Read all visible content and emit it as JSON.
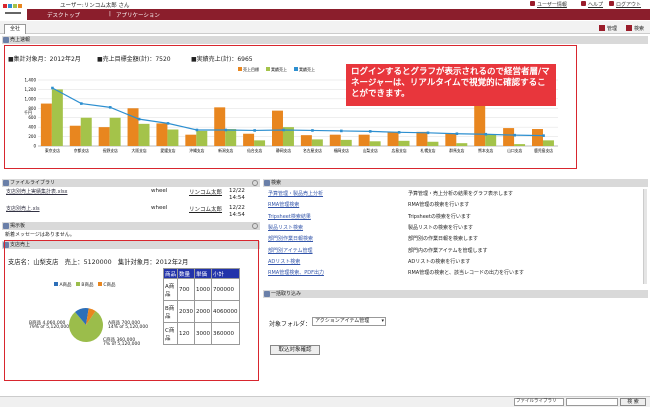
{
  "header": {
    "user": "ユーザー:リンコム太郎 さん",
    "links": [
      "ユーザー情報",
      "ヘルプ",
      "ログアウト"
    ]
  },
  "nav": {
    "items": [
      "デスクトップ",
      "アプリケーション"
    ]
  },
  "tab": {
    "label": "全社"
  },
  "top_right": {
    "manage": "管理",
    "search": "検索"
  },
  "sales_panel": {
    "title": "売上速報",
    "period": "■集計対象月：2012年2月",
    "target": "■売上目標金額(計)：7520",
    "actual": "■実績売上(計)：6965",
    "overlay": "ログインするとグラフが表示されるので経営者層/マネージャーは、リアルタイムで視覚的に確認することができます。"
  },
  "chart_data": {
    "type": "bar",
    "categories": [
      "東京支店",
      "京都支店",
      "長野支店",
      "大阪支店",
      "愛媛支店",
      "沖縄支店",
      "新潟支店",
      "仙台支店",
      "静岡支店",
      "名古屋支店",
      "福岡支店",
      "山梨支店",
      "広島支店",
      "札幌支店",
      "群馬支店",
      "熊本支店",
      "山口支店",
      "鹿児島支店"
    ],
    "series": [
      {
        "name": "売上目標",
        "values": [
          900,
          430,
          400,
          800,
          480,
          240,
          820,
          260,
          750,
          230,
          240,
          240,
          300,
          300,
          270,
          1000,
          380,
          360
        ],
        "color": "#e8861f"
      },
      {
        "name": "実績売上",
        "values": [
          1200,
          600,
          600,
          470,
          350,
          320,
          360,
          120,
          400,
          140,
          130,
          100,
          110,
          90,
          60,
          240,
          40,
          120
        ],
        "color": "#a4c34a"
      },
      {
        "name": "実績売上",
        "values": [
          1230,
          900,
          820,
          570,
          480,
          340,
          340,
          330,
          340,
          330,
          320,
          310,
          290,
          280,
          260,
          250,
          230,
          220
        ],
        "color": "#2d8fd0"
      }
    ],
    "ylim": [
      0,
      1400
    ],
    "yticks": [
      "0",
      "200",
      "400",
      "600",
      "800",
      "1,000",
      "1,200",
      "1,400"
    ],
    "ylabel": "千円",
    "legend_placement": "top",
    "grid": true
  },
  "file_panel": {
    "title": "ファイルライブラリ",
    "rows": [
      {
        "name": "支店別売上実績集計表.xlsx",
        "owner": "wheel",
        "creator": "リンコム太郎",
        "date": "12/22",
        "time": "14:54"
      },
      {
        "name": "支店別売上.xls",
        "owner": "wheel",
        "creator": "リンコム太郎",
        "date": "12/22",
        "time": "14:54"
      }
    ]
  },
  "board_panel": {
    "title": "掲示板",
    "message": "新着メッセージはありません。"
  },
  "store_panel": {
    "title": "支店売上",
    "info": "支店名：山梨支店　売上：5120000　集計対象月：2012年2月",
    "legend": [
      "A商品",
      "B商品",
      "C商品"
    ],
    "pie": {
      "slices": [
        {
          "name": "B商品",
          "value": 4060000,
          "color": "#9bbd4b"
        },
        {
          "name": "A商品",
          "value": 700000,
          "color": "#2d6fb8"
        },
        {
          "name": "C商品",
          "value": 360000,
          "color": "#e8861f"
        }
      ]
    },
    "pie_labels": {
      "b": "B商品 4,060,000",
      "b2": "79% of 5,120,000",
      "a": "A商品 700,000",
      "a2": "14% of 5,120,000",
      "c": "C商品 360,000",
      "c2": "7% of 5,120,000"
    },
    "table": {
      "headers": [
        "商品",
        "数量",
        "単価",
        "小計"
      ],
      "rows": [
        [
          "A商品",
          "700",
          "1000",
          "700000"
        ],
        [
          "B商品",
          "2030",
          "2000",
          "4060000"
        ],
        [
          "C商品",
          "120",
          "3000",
          "360000"
        ]
      ]
    }
  },
  "search_panel": {
    "title": "検索",
    "rows": [
      {
        "link": "予算管理・製品売上分析",
        "desc": "予算管理・売上分析の結果をグラフ表示します"
      },
      {
        "link": "RMA管理検索",
        "desc": "RMA管理の検索を行います"
      },
      {
        "link": "Tripsheet検索結果",
        "desc": "Tripsheetの検索を行います"
      },
      {
        "link": "製品リスト検索",
        "desc": "製品リストの検索を行います"
      },
      {
        "link": "部門別作業日報検索",
        "desc": "部門別の作業日報を検索します"
      },
      {
        "link": "部門別アイテム管理",
        "desc": "部門内の作業アイテムを管理します"
      },
      {
        "link": "ADリスト検索",
        "desc": "ADリストの検索を行います"
      },
      {
        "link": "RMA管理検索、PDF出力",
        "desc": "RMA管理の検索と、該当レコードの出力を行います"
      }
    ]
  },
  "import_panel": {
    "title": "一括取り込み",
    "folder_label": "対象フォルダ：",
    "folder_value": "アクションアイテム管理",
    "button": "取込対象確認"
  },
  "statusbar": {
    "select": "ファイルライブラリ",
    "button": "検 索"
  }
}
